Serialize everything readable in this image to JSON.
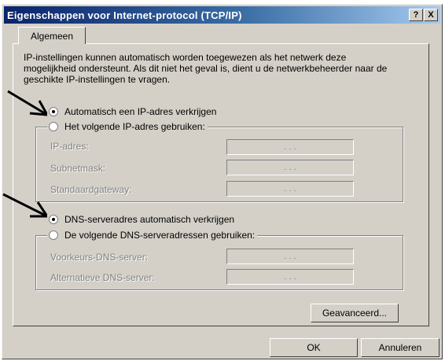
{
  "window": {
    "title": "Eigenschappen voor Internet-protocol (TCP/IP)",
    "help_label": "?",
    "close_label": "X"
  },
  "tabs": [
    {
      "label": "Algemeen",
      "active": true
    }
  ],
  "intro_text": "IP-instellingen kunnen automatisch worden toegewezen als het netwerk deze mogelijkheid ondersteunt. Als dit niet het geval is, dient u de netwerkbeheerder naar de geschikte IP-instellingen te vragen.",
  "ip_section": {
    "auto_label": "Automatisch een IP-adres verkrijgen",
    "auto_selected": true,
    "manual_label": "Het volgende IP-adres gebruiken:",
    "manual_selected": false,
    "fields": [
      {
        "label": "IP-adres:",
        "value": ". . ."
      },
      {
        "label": "Subnetmask:",
        "value": ". . ."
      },
      {
        "label": "Standaardgateway:",
        "value": ". . ."
      }
    ]
  },
  "dns_section": {
    "auto_label": "DNS-serveradres automatisch verkrijgen",
    "auto_selected": true,
    "manual_label": "De volgende DNS-serveradressen gebruiken:",
    "manual_selected": false,
    "fields": [
      {
        "label": "Voorkeurs-DNS-server:",
        "value": ". . ."
      },
      {
        "label": "Alternatieve DNS-server:",
        "value": ". . ."
      }
    ]
  },
  "buttons": {
    "advanced": "Geavanceerd...",
    "ok": "OK",
    "cancel": "Annuleren"
  },
  "colors": {
    "face": "#d4d0c8",
    "title_start": "#0a246a",
    "title_end": "#a6caf0",
    "disabled_text": "#808080"
  }
}
